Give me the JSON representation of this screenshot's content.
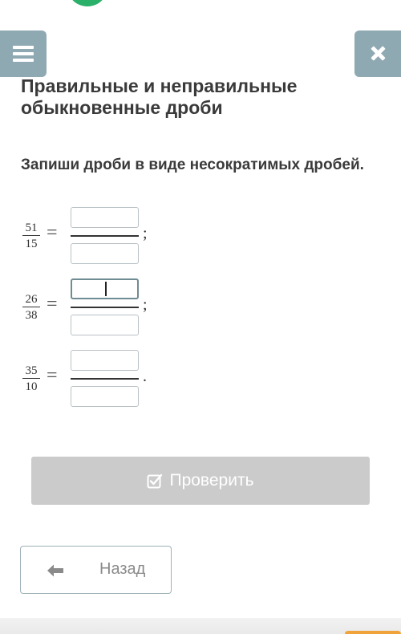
{
  "header": {
    "menu_icon": "hamburger-icon",
    "close_icon": "close-icon"
  },
  "lesson": {
    "title": "Правильные и неправильные обыкновенные дроби",
    "instruction": "Запиши дроби в виде несократимых дробей."
  },
  "exercises": [
    {
      "numerator": "51",
      "denominator": "15",
      "equals": "=",
      "punctuation": ";",
      "answer_numerator": "",
      "answer_denominator": ""
    },
    {
      "numerator": "26",
      "denominator": "38",
      "equals": "=",
      "punctuation": ";",
      "answer_numerator": "",
      "answer_denominator": ""
    },
    {
      "numerator": "35",
      "denominator": "10",
      "equals": "=",
      "punctuation": ".",
      "answer_numerator": "",
      "answer_denominator": ""
    }
  ],
  "actions": {
    "check_label": "Проверить",
    "check_icon": "checkbox-check-icon",
    "back_label": "Назад",
    "back_icon": "arrow-left-icon"
  },
  "colors": {
    "accent_green": "#2bb06a",
    "nav_button": "#8fa9b3",
    "check_button": "#cbcbcb",
    "bottom_accent": "#f0a23b"
  }
}
